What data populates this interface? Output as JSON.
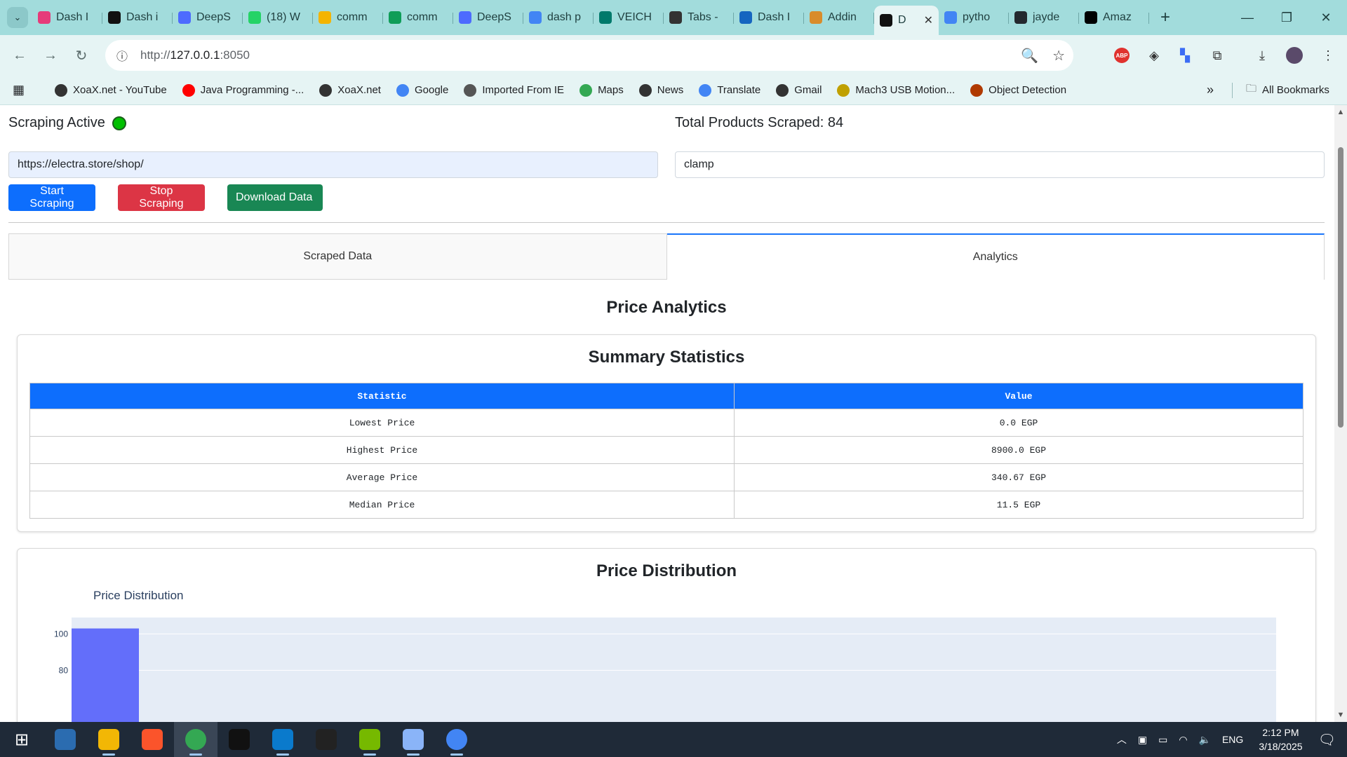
{
  "browser": {
    "tabs": [
      {
        "title": "Dash I",
        "color": "#e63b7a"
      },
      {
        "title": "Dash i",
        "color": "#111111"
      },
      {
        "title": "DeepS",
        "color": "#4d6bfe"
      },
      {
        "title": "(18) W",
        "color": "#25d366"
      },
      {
        "title": "comm",
        "color": "#f4b400"
      },
      {
        "title": "comm",
        "color": "#0f9d58"
      },
      {
        "title": "DeepS",
        "color": "#4d6bfe"
      },
      {
        "title": "dash p",
        "color": "#4285f4"
      },
      {
        "title": "VEICH",
        "color": "#00796b"
      },
      {
        "title": "Tabs -",
        "color": "#333333"
      },
      {
        "title": "Dash I",
        "color": "#1565c0"
      },
      {
        "title": "Addin",
        "color": "#d98c2b"
      },
      {
        "title": "D",
        "color": "#111111"
      },
      {
        "title": "pytho",
        "color": "#4285f4"
      },
      {
        "title": "jayde",
        "color": "#24292f"
      },
      {
        "title": "Amaz",
        "color": "#000000"
      }
    ],
    "active_tab_index": 12,
    "address": {
      "scheme": "http://",
      "host": "127.0.0.1",
      "port": ":8050"
    },
    "bookmarks": [
      {
        "label": "XoaX.net - YouTube",
        "color": "#333333"
      },
      {
        "label": "Java Programming -...",
        "color": "#ff0000"
      },
      {
        "label": "XoaX.net",
        "color": "#333333"
      },
      {
        "label": "Google",
        "color": "#4285f4"
      },
      {
        "label": "Imported From IE",
        "color": "#555555"
      },
      {
        "label": "Maps",
        "color": "#34a853"
      },
      {
        "label": "News",
        "color": "#333333"
      },
      {
        "label": "Translate",
        "color": "#4285f4"
      },
      {
        "label": "Gmail",
        "color": "#333333"
      },
      {
        "label": "Mach3 USB Motion...",
        "color": "#c0a000"
      },
      {
        "label": "Object Detection",
        "color": "#b03a00"
      }
    ],
    "all_bookmarks_label": "All Bookmarks",
    "abp_label": "ABP"
  },
  "app": {
    "status_label": "Scraping Active",
    "total_label": "Total Products Scraped: 84",
    "url_value": "https://electra.store/shop/",
    "keyword_value": "clamp",
    "buttons": {
      "start": "Start Scraping",
      "stop": "Stop Scraping",
      "download": "Download Data"
    },
    "tabs": {
      "scraped": "Scraped Data",
      "analytics": "Analytics"
    },
    "analytics_title": "Price Analytics",
    "summary": {
      "title": "Summary Statistics",
      "headers": [
        "Statistic",
        "Value"
      ],
      "rows": [
        [
          "Lowest Price",
          "0.0 EGP"
        ],
        [
          "Highest Price",
          "8900.0 EGP"
        ],
        [
          "Average Price",
          "340.67 EGP"
        ],
        [
          "Median Price",
          "11.5 EGP"
        ]
      ]
    },
    "distribution": {
      "card_title": "Price Distribution",
      "plot_title": "Price Distribution"
    }
  },
  "chart_data": {
    "type": "bar",
    "title": "Price Distribution",
    "xlabel": "",
    "ylabel": "",
    "y_ticks": [
      "100",
      "80"
    ],
    "visible_ylim": [
      74,
      109
    ],
    "bars": [
      {
        "bin_index": 0,
        "value": 103
      }
    ],
    "colors": {
      "bar": "#636efa",
      "plot_bg": "#e5ecf6"
    }
  },
  "taskbar": {
    "apps": [
      {
        "name": "start-menu",
        "color": "#1f2a38"
      },
      {
        "name": "microsoft-store",
        "color": "#2b6cb0"
      },
      {
        "name": "file-explorer",
        "color": "#f2b705"
      },
      {
        "name": "brave",
        "color": "#fb542b"
      },
      {
        "name": "chrome",
        "color": "#34a853"
      },
      {
        "name": "terminal",
        "color": "#111111"
      },
      {
        "name": "vscode",
        "color": "#0a7acc"
      },
      {
        "name": "7zip",
        "color": "#222222"
      },
      {
        "name": "notepad-plus",
        "color": "#76b900"
      },
      {
        "name": "paint",
        "color": "#8ab4f8"
      },
      {
        "name": "chromium",
        "color": "#4285f4"
      }
    ],
    "language": "ENG",
    "time": "2:12 PM",
    "date": "3/18/2025"
  }
}
